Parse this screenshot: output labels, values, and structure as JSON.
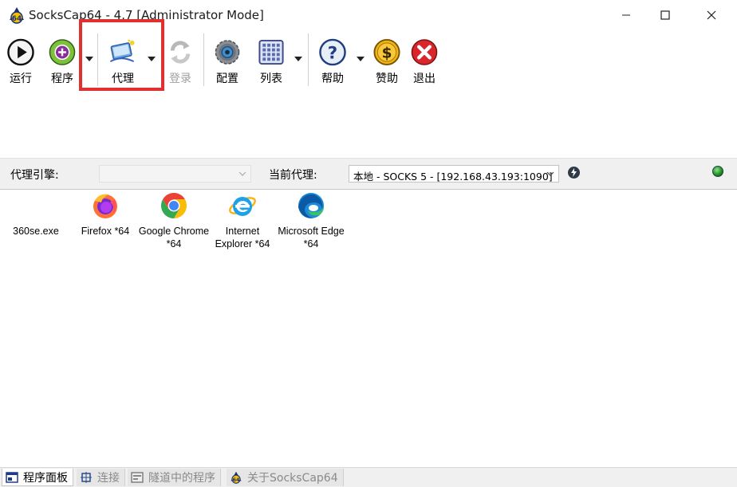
{
  "window": {
    "title": "SocksCap64 - 4.7 [Administrator Mode]"
  },
  "toolbar": {
    "run_label": "运行",
    "programs_label": "程序",
    "proxy_label": "代理",
    "login_label": "登录",
    "config_label": "配置",
    "list_label": "列表",
    "help_label": "帮助",
    "donate_label": "赞助",
    "exit_label": "退出"
  },
  "proxy_bar": {
    "engine_label": "代理引擎:",
    "engine_value": "",
    "current_label": "当前代理:",
    "current_value": "本地 - SOCKS 5 - [192.168.43.193:1090]"
  },
  "programs": [
    {
      "name": "360se.exe",
      "icon": "360se-icon"
    },
    {
      "name": "Firefox *64",
      "icon": "firefox-icon"
    },
    {
      "name": "Google Chrome *64",
      "icon": "chrome-icon"
    },
    {
      "name": "Internet Explorer *64",
      "icon": "internet-explorer-icon"
    },
    {
      "name": "Microsoft Edge *64",
      "icon": "edge-icon"
    }
  ],
  "tabs": [
    {
      "label": "程序面板",
      "active": true
    },
    {
      "label": "连接",
      "active": false
    },
    {
      "label": "隧道中的程序",
      "active": false
    },
    {
      "label": "关于SocksCap64",
      "active": false
    }
  ],
  "colors": {
    "highlight_box": "#e03030",
    "status_led": "#1b8a1b"
  }
}
